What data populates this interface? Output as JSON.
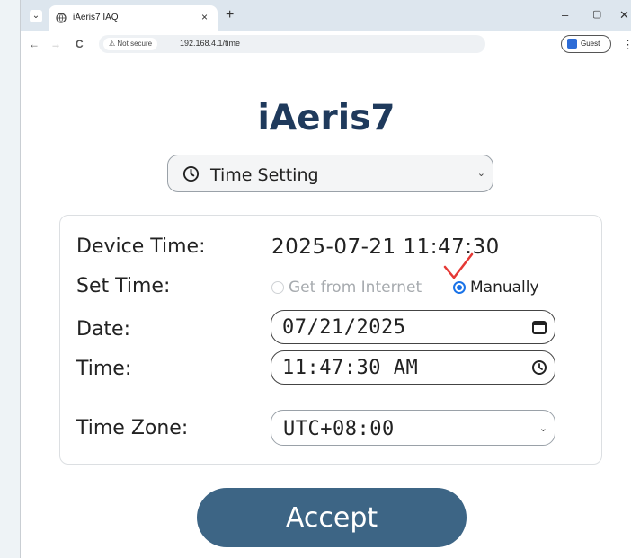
{
  "browser": {
    "tab_title": "iAeris7 IAQ",
    "tab_close": "×",
    "new_tab": "+",
    "tab_menu": "⌄",
    "minimize": "–",
    "maximize": "▢",
    "close": "✕",
    "back": "←",
    "forward": "→",
    "reload": "C",
    "security_label": "Not secure",
    "url": "192.168.4.1/time",
    "profile_label": "Guest",
    "menu": "⋮"
  },
  "page": {
    "title": "iAeris7",
    "mode_select": {
      "icon": "clock-icon",
      "value": "Time Setting"
    },
    "device_time": {
      "label": "Device Time:",
      "value": "2025-07-21 11:47:30"
    },
    "set_time": {
      "label": "Set Time:",
      "options": [
        {
          "label": "Get from Internet",
          "selected": false
        },
        {
          "label": "Manually",
          "selected": true
        }
      ]
    },
    "date": {
      "label": "Date:",
      "value": "07/21/2025",
      "icon": "calendar-icon"
    },
    "time": {
      "label": "Time:",
      "value": "11:47:30 AM",
      "icon": "clock-icon"
    },
    "time_zone": {
      "label": "Time Zone:",
      "value": "UTC+08:00"
    },
    "accept_label": "Accept"
  },
  "colors": {
    "title": "#1f3a5c",
    "accept_button": "#3d6585",
    "radio_selected": "#1a73e8",
    "annotation_check": "#e53935"
  }
}
